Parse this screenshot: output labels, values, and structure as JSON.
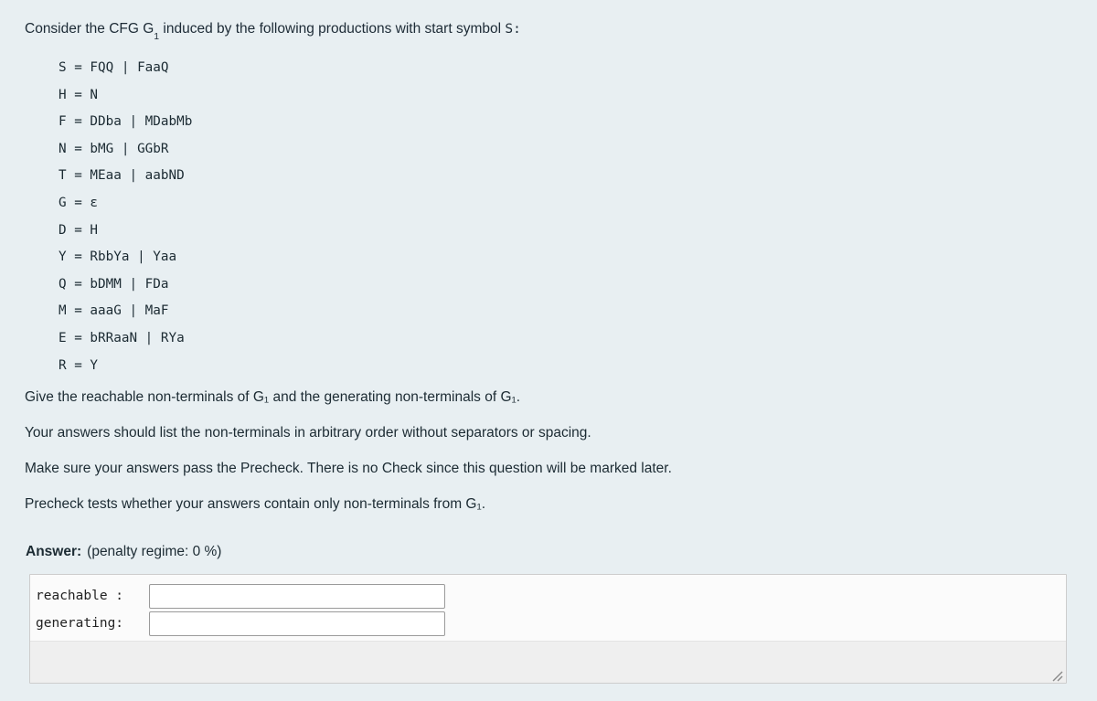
{
  "question": {
    "intro_before": "Consider the CFG G",
    "intro_sub": "1",
    "intro_after": " induced by the following productions with start symbol ",
    "intro_start_symbol": "S:",
    "productions": [
      "S = FQQ | FaaQ",
      "H = N",
      "F = DDba | MDabMb",
      "N = bMG | GGbR",
      "T = MEaa | aabND",
      "G = ε",
      "D = H",
      "Y = RbbYa | Yaa",
      "Q = bDMM | FDa",
      "M = aaaG | MaF",
      "E = bRRaaN | RYa",
      "R = Y"
    ],
    "paragraphs": [
      "Give the reachable non-terminals of G₁ and the generating non-terminals of G₁.",
      "Your answers should list the non-terminals in arbitrary order without separators or spacing.",
      "Make sure your answers pass the Precheck. There is no Check since this question will be marked later.",
      "Precheck tests whether your answers contain only non-terminals from G₁."
    ]
  },
  "answer": {
    "label": "Answer:",
    "penalty": "(penalty regime: 0 %)",
    "fields": [
      {
        "label": "reachable :",
        "value": "",
        "placeholder": ""
      },
      {
        "label": "generating:",
        "value": "",
        "placeholder": ""
      }
    ]
  },
  "colors": {
    "page_background": "#e8eff2",
    "text": "#1c2b33",
    "answer_box_background": "#f7f7f8",
    "answer_box_border": "#cdcdcd",
    "input_border": "#9a9a9a",
    "footer_background": "#efefef"
  }
}
